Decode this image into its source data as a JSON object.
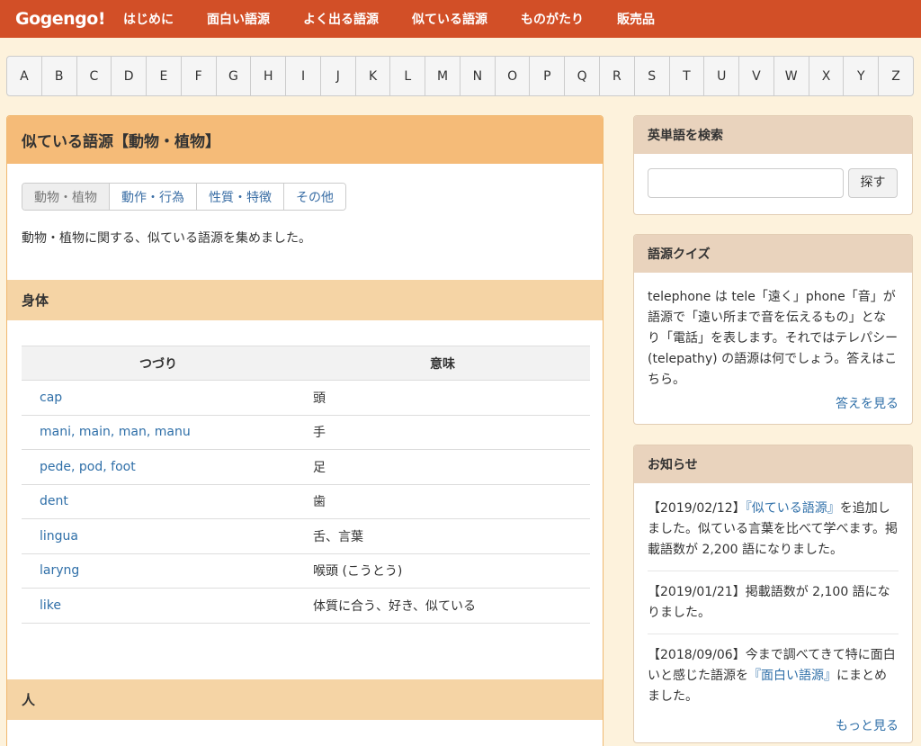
{
  "nav": {
    "logo": "Gogengo!",
    "items": [
      "はじめに",
      "面白い語源",
      "よく出る語源",
      "似ている語源",
      "ものがたり",
      "販売品"
    ]
  },
  "alphabet": [
    "A",
    "B",
    "C",
    "D",
    "E",
    "F",
    "G",
    "H",
    "I",
    "J",
    "K",
    "L",
    "M",
    "N",
    "O",
    "P",
    "Q",
    "R",
    "S",
    "T",
    "U",
    "V",
    "W",
    "X",
    "Y",
    "Z"
  ],
  "main": {
    "title": "似ている語源【動物・植物】",
    "tabs": [
      "動物・植物",
      "動作・行為",
      "性質・特徴",
      "その他"
    ],
    "active_tab": "動物・植物",
    "intro": "動物・植物に関する、似ている語源を集めました。",
    "sections": [
      {
        "title": "身体",
        "columns": [
          "つづり",
          "意味"
        ],
        "rows": [
          {
            "spelling": "cap",
            "meaning": "頭"
          },
          {
            "spelling": "mani, main, man, manu",
            "meaning": "手"
          },
          {
            "spelling": "pede, pod, foot",
            "meaning": "足"
          },
          {
            "spelling": "dent",
            "meaning": "歯"
          },
          {
            "spelling": "lingua",
            "meaning": "舌、言葉"
          },
          {
            "spelling": "laryng",
            "meaning": "喉頭 (こうとう)"
          },
          {
            "spelling": "like",
            "meaning": "体質に合う、好き、似ている"
          }
        ]
      },
      {
        "title": "人"
      }
    ]
  },
  "sidebar": {
    "search": {
      "title": "英単語を検索",
      "button": "探す",
      "value": ""
    },
    "quiz": {
      "title": "語源クイズ",
      "text": "telephone は tele「遠く」phone「音」が語源で「遠い所まで音を伝えるもの」となり「電話」を表します。それではテレパシー (telepathy) の語源は何でしょう。答えはこちら。",
      "link": "答えを見る"
    },
    "news": {
      "title": "お知らせ",
      "items": [
        {
          "date": "【2019/02/12】",
          "pre": "",
          "link": "『似ている語源』",
          "post": "を追加しました。似ている言葉を比べて学べます。掲載語数が 2,200 語になりました。"
        },
        {
          "date": "【2019/01/21】",
          "pre": "掲載語数が 2,100 語になりました。",
          "link": "",
          "post": ""
        },
        {
          "date": "【2018/09/06】",
          "pre": "今まで調べてきて特に面白いと感じた語源を",
          "link": "『面白い語源』",
          "post": "にまとめました。"
        }
      ],
      "more": "もっと見る"
    }
  }
}
